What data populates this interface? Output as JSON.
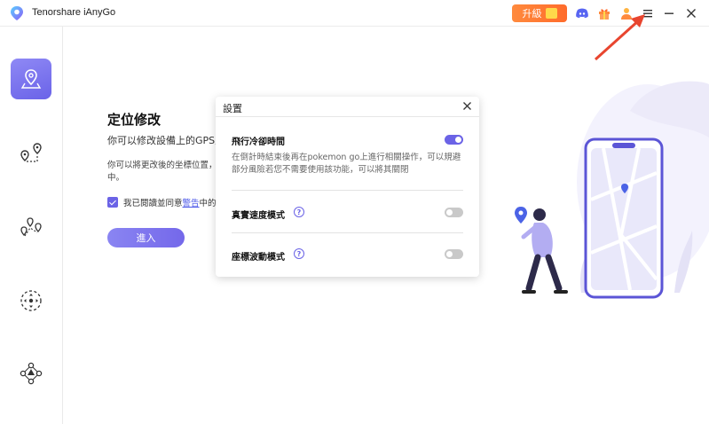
{
  "app": {
    "title": "Tenorshare iAnyGo",
    "upgrade_label": "升級"
  },
  "titlebar_icons": [
    "discord-icon",
    "gift-icon",
    "user-icon",
    "menu-icon",
    "minimize-icon",
    "close-icon"
  ],
  "sidebar": {
    "items": [
      {
        "name": "change-location",
        "icon": "map-pin-icon",
        "active": true
      },
      {
        "name": "two-spot-move",
        "icon": "two-pins-route-icon",
        "active": false
      },
      {
        "name": "multi-spot-move",
        "icon": "multi-pins-route-icon",
        "active": false
      },
      {
        "name": "joystick-move",
        "icon": "joystick-icon",
        "active": false
      },
      {
        "name": "gpx-import",
        "icon": "network-nodes-icon",
        "active": false
      }
    ]
  },
  "main": {
    "title": "定位修改",
    "description": "你可以修改設備上的GPS定",
    "description2_line1": "你可以將更改後的坐標位置，應",
    "description2_line2": "中。",
    "agree_prefix": "我已閱讀並同意",
    "agree_link": "警告",
    "agree_suffix": "中的內",
    "enter_label": "進入"
  },
  "dialog": {
    "title": "設置",
    "settings": [
      {
        "label": "飛行冷卻時間",
        "enabled": true,
        "description": "在倒計時結束後再在pokemon go上進行相關操作，可以規避部分風險若您不需要使用該功能，可以將其關閉"
      },
      {
        "label": "真實速度模式",
        "enabled": false,
        "help": true
      },
      {
        "label": "座標波動模式",
        "enabled": false,
        "help": true
      }
    ],
    "help_glyph": "?"
  },
  "colors": {
    "accent": "#6b63e6",
    "upgrade": "#ff7a33",
    "annotation_arrow": "#e8452f"
  }
}
